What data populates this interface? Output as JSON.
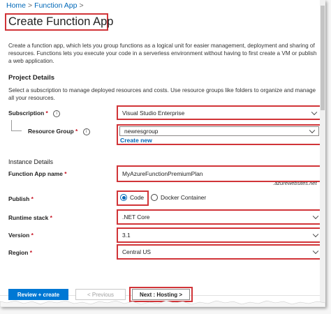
{
  "breadcrumb": {
    "home": "Home",
    "sep": ">",
    "current": "Function App",
    "trail_sep": ">"
  },
  "header": {
    "title": "Create Function App"
  },
  "intro": {
    "line1": "Create a function app, which lets you group functions as a logical unit for easier management, deployment and sharing of",
    "line2": "resources. Functions lets you execute your code in a serverless environment without having to first create a VM or publish",
    "line3": "a web application."
  },
  "project": {
    "heading": "Project Details",
    "line1": "Select a subscription to manage deployed resources and costs. Use resource groups like folders to organize and manage",
    "line2": "all your resources.",
    "subscription_label": "Subscription",
    "subscription_value": "Visual Studio Enterprise",
    "resource_group_label": "Resource Group",
    "resource_group_value": "newresgroup",
    "create_new": "Create new"
  },
  "instance": {
    "heading": "Instance Details",
    "name_label": "Function App name",
    "name_value": "MyAzureFunctionPremiumPlan",
    "name_suffix": ".azurewebsites.net",
    "publish_label": "Publish",
    "publish_options": [
      "Code",
      "Docker Container"
    ],
    "publish_selected": "Code",
    "runtime_label": "Runtime stack",
    "runtime_value": ".NET Core",
    "version_label": "Version",
    "version_value": "3.1",
    "region_label": "Region",
    "region_value": "Central US"
  },
  "required_marker": "*",
  "info_glyph": "i",
  "footer": {
    "review_label": "Review + create",
    "previous_label": "< Previous",
    "next_label": "Next : Hosting >"
  },
  "icons": [
    "info-icon",
    "chevron-down-icon",
    "chevron-right-icon"
  ],
  "colors": {
    "accent": "#0078d4",
    "link": "#0068b8",
    "highlight": "#d13438",
    "required": "#c50f1f"
  }
}
